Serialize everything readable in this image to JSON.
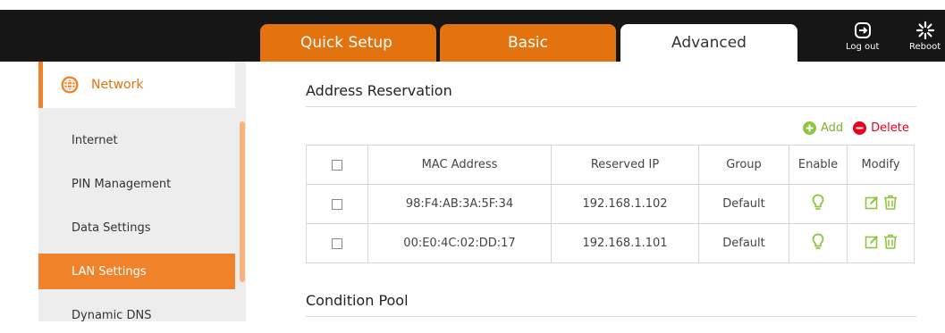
{
  "header": {
    "tabs": [
      {
        "label": "Quick Setup"
      },
      {
        "label": "Basic"
      },
      {
        "label": "Advanced"
      }
    ],
    "logout_label": "Log out",
    "reboot_label": "Reboot"
  },
  "sidebar": {
    "section": {
      "label": "Network",
      "icon": "globe-icon"
    },
    "items": [
      {
        "label": "Internet"
      },
      {
        "label": "PIN Management"
      },
      {
        "label": "Data Settings"
      },
      {
        "label": "LAN Settings",
        "active": true
      },
      {
        "label": "Dynamic DNS"
      }
    ]
  },
  "main": {
    "address_reservation_title": "Address Reservation",
    "add_label": "Add",
    "delete_label": "Delete",
    "table": {
      "headers": [
        "",
        "MAC Address",
        "Reserved IP",
        "Group",
        "Enable",
        "Modify"
      ],
      "rows": [
        {
          "mac": "98:F4:AB:3A:5F:34",
          "ip": "192.168.1.102",
          "group": "Default",
          "enabled": true
        },
        {
          "mac": "00:E0:4C:02:DD:17",
          "ip": "192.168.1.101",
          "group": "Default",
          "enabled": true
        }
      ]
    },
    "condition_pool_title": "Condition Pool"
  },
  "colors": {
    "accent": "#e3730f",
    "sidebar_active": "#f0832a",
    "green": "#8cc63f",
    "red": "#e8001c"
  }
}
